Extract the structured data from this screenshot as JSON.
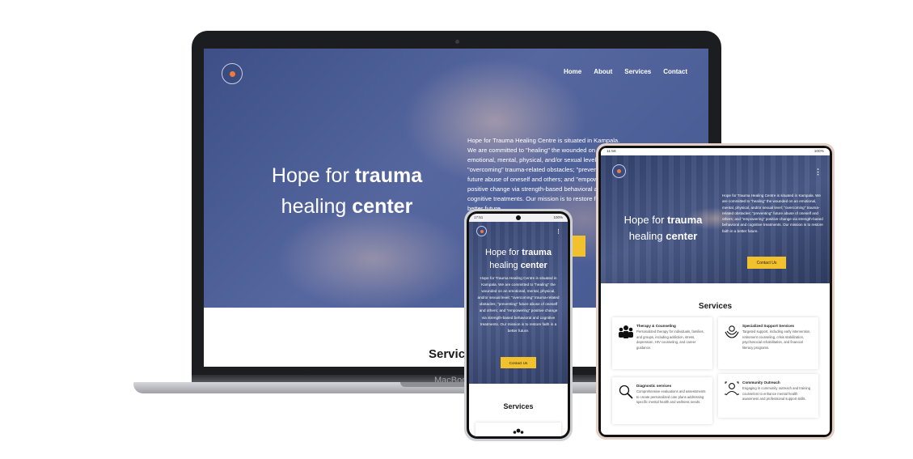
{
  "site": {
    "nav": [
      "Home",
      "About",
      "Services",
      "Contact"
    ],
    "hero_title_line1_light": "Hope for",
    "hero_title_line1_bold": "trauma",
    "hero_title_line2_light": "healing",
    "hero_title_line2_bold": "center",
    "hero_paragraph": "Hope for Trauma Healing Centre is situated in Kampala. We are committed to \"healing\" the wounded on an emotional, mental, physical, and/or sexual level; \"overcoming\" trauma-related obstacles; \"preventing\" future abuse of oneself and others; and \"empowering\" positive change via strength-based behavioral and cognitive treatments. Our mission is to restore faith in a better future.",
    "cta": "Contact Us",
    "services_heading": "Services",
    "services": [
      {
        "icon": "group-icon",
        "title": "Therapy & Counseling",
        "desc": "Personalized therapy for individuals, families, and groups, including addiction, stress, depression, HIV counseling, and career guidance."
      },
      {
        "icon": "support-hands-icon",
        "title": "Specialized Support Services",
        "desc": "Targeted support, including early intervention, retirement counseling, crisis stabilization, psychosocial rehabilitation, and financial literacy programs."
      },
      {
        "icon": "magnifier-icon",
        "title": "Diagnostic services",
        "desc": "Comprehensive evaluations and assessments to create personalized care plans addressing specific mental health and wellness needs."
      },
      {
        "icon": "outreach-icon",
        "title": "Community Outreach",
        "desc": "Engaging in community outreach and training counselors to enhance mental health awareness and professional support skills."
      }
    ]
  },
  "laptop": {
    "brand": "MacBook",
    "services_heading_cropped": "Servic"
  },
  "tablet": {
    "status_time": "11:56",
    "status_battery": "100%"
  },
  "phone": {
    "status_time": "17:51",
    "status_battery": "100%"
  },
  "colors": {
    "hero_blue": "#4b5b8f",
    "cta_yellow": "#f2c12e",
    "logo_orange": "#f07a3a"
  }
}
